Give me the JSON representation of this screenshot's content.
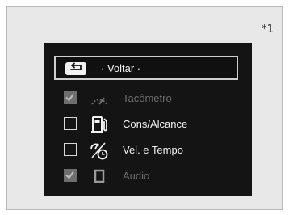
{
  "note_marker": "*1",
  "menu": {
    "back_label": "· Voltar ·",
    "items": [
      {
        "label": "Tacômetro",
        "checked": true,
        "dimmed": true,
        "icon": "tachometer-icon"
      },
      {
        "label": "Cons/Alcance",
        "checked": false,
        "dimmed": false,
        "icon": "fuel-consumption-icon"
      },
      {
        "label": "Vel. e Tempo",
        "checked": false,
        "dimmed": false,
        "icon": "speed-time-icon"
      },
      {
        "label": "Áudio",
        "checked": true,
        "dimmed": true,
        "icon": "audio-icon"
      }
    ]
  },
  "colors": {
    "screen_bg": "#141414",
    "text": "#f2f2f2",
    "dim_text": "#6e6e6e",
    "frame_bg": "#e8e8e8"
  }
}
